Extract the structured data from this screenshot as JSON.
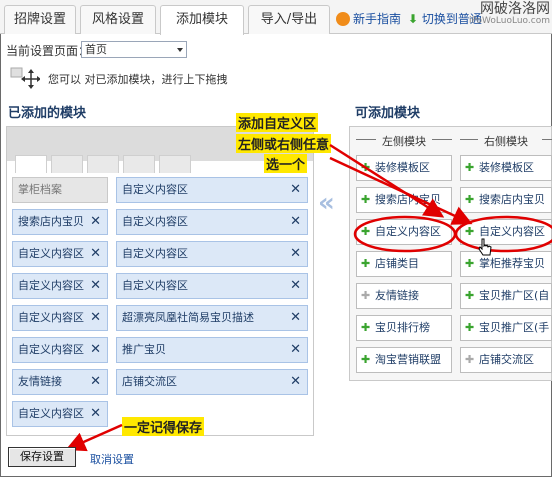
{
  "tabs": [
    "招牌设置",
    "风格设置",
    "添加模块",
    "导入/导出"
  ],
  "active_tab": "添加模块",
  "top_links": {
    "guide": "新手指南",
    "switch": "切换到普通"
  },
  "watermark": {
    "main": "网破洛洛网",
    "sub": "iPoWoLuoLuo.com"
  },
  "page_select": {
    "label": "当前设置页面：",
    "value": "首页"
  },
  "hint": "您可以 对已添加模块，进行上下拖拽",
  "added_header": "已添加的模块",
  "available_header": "可添加模块",
  "added_left": [
    "掌柜档案",
    "搜索店内宝贝",
    "自定义内容区",
    "自定义内容区",
    "自定义内容区",
    "自定义内容区",
    "友情链接",
    "自定义内容区"
  ],
  "added_right": [
    "自定义内容区",
    "自定义内容区",
    "自定义内容区",
    "自定义内容区",
    "超漂亮凤凰社简易宝贝描述",
    "推广宝贝",
    "店铺交流区"
  ],
  "col_left_title": "左侧模块",
  "col_right_title": "右侧模块",
  "avail_left": [
    "装修模板区",
    "搜索店内宝贝",
    "自定义内容区",
    "店铺类目",
    "友情链接",
    "宝贝排行榜",
    "淘宝营销联盟"
  ],
  "avail_right": [
    "装修模板区",
    "搜索店内宝贝",
    "自定义内容区",
    "掌柜推荐宝贝",
    "宝贝推广区(自",
    "宝贝推广区(手",
    "店铺交流区"
  ],
  "annotation_top": [
    "添加自定义区",
    "左侧或右侧任意",
    "选一个"
  ],
  "annotation_bottom": "一定记得保存",
  "save_label": "保存设置",
  "cancel_label": "取消设置",
  "colors": {
    "accent": "#1f3d66",
    "annotation_bg": "#ffe800",
    "arrow": "#e00000",
    "module_bg": "#dce8f7"
  }
}
